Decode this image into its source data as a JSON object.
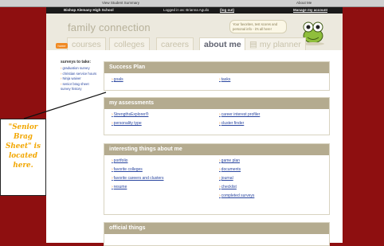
{
  "browser": {
    "left_tab": "View Student Summary",
    "right_tab": "About Me"
  },
  "topbar": {
    "school": "Bishop Alemany High School",
    "logged_in": "Logged in as: Brianna Aguilo",
    "logout": "(log out)",
    "manage": "Manage my account"
  },
  "header": {
    "brand": "family connection",
    "bubble": "Your favorites, test scores and personal info - it's all here!",
    "home_badge": "home"
  },
  "tabs": {
    "courses": "courses",
    "colleges": "colleges",
    "careers": "careers",
    "about_me": "about me",
    "my_planner": "my planner"
  },
  "sidebar": {
    "title": "surveys to take:",
    "items": [
      "graduation survey",
      "christian service hours",
      "Ninja waiver",
      "senior brag sheet"
    ],
    "history": "survey history"
  },
  "success_plan": {
    "title": "Success Plan",
    "goals": "goals",
    "tasks": "tasks"
  },
  "assessments": {
    "title": "my assessments",
    "left": [
      "StrengthsExplorer®",
      "personality type"
    ],
    "right": [
      "career interest profiler",
      "cluster finder"
    ]
  },
  "interesting": {
    "title": "interesting things about me",
    "left": [
      "portfolio",
      "favorite colleges",
      "favorite careers and clusters",
      "resume"
    ],
    "right": [
      "game plan",
      "documents",
      "journal",
      "checklist",
      "completed surveys"
    ]
  },
  "official": {
    "title": "official things"
  },
  "callout": {
    "text": "\"Senior Brag Sheet\" is located here."
  },
  "colors": {
    "background": "#8e0f10",
    "accent": "#f08a24",
    "section_header": "#b4ab8f",
    "link": "#2b47a0"
  }
}
